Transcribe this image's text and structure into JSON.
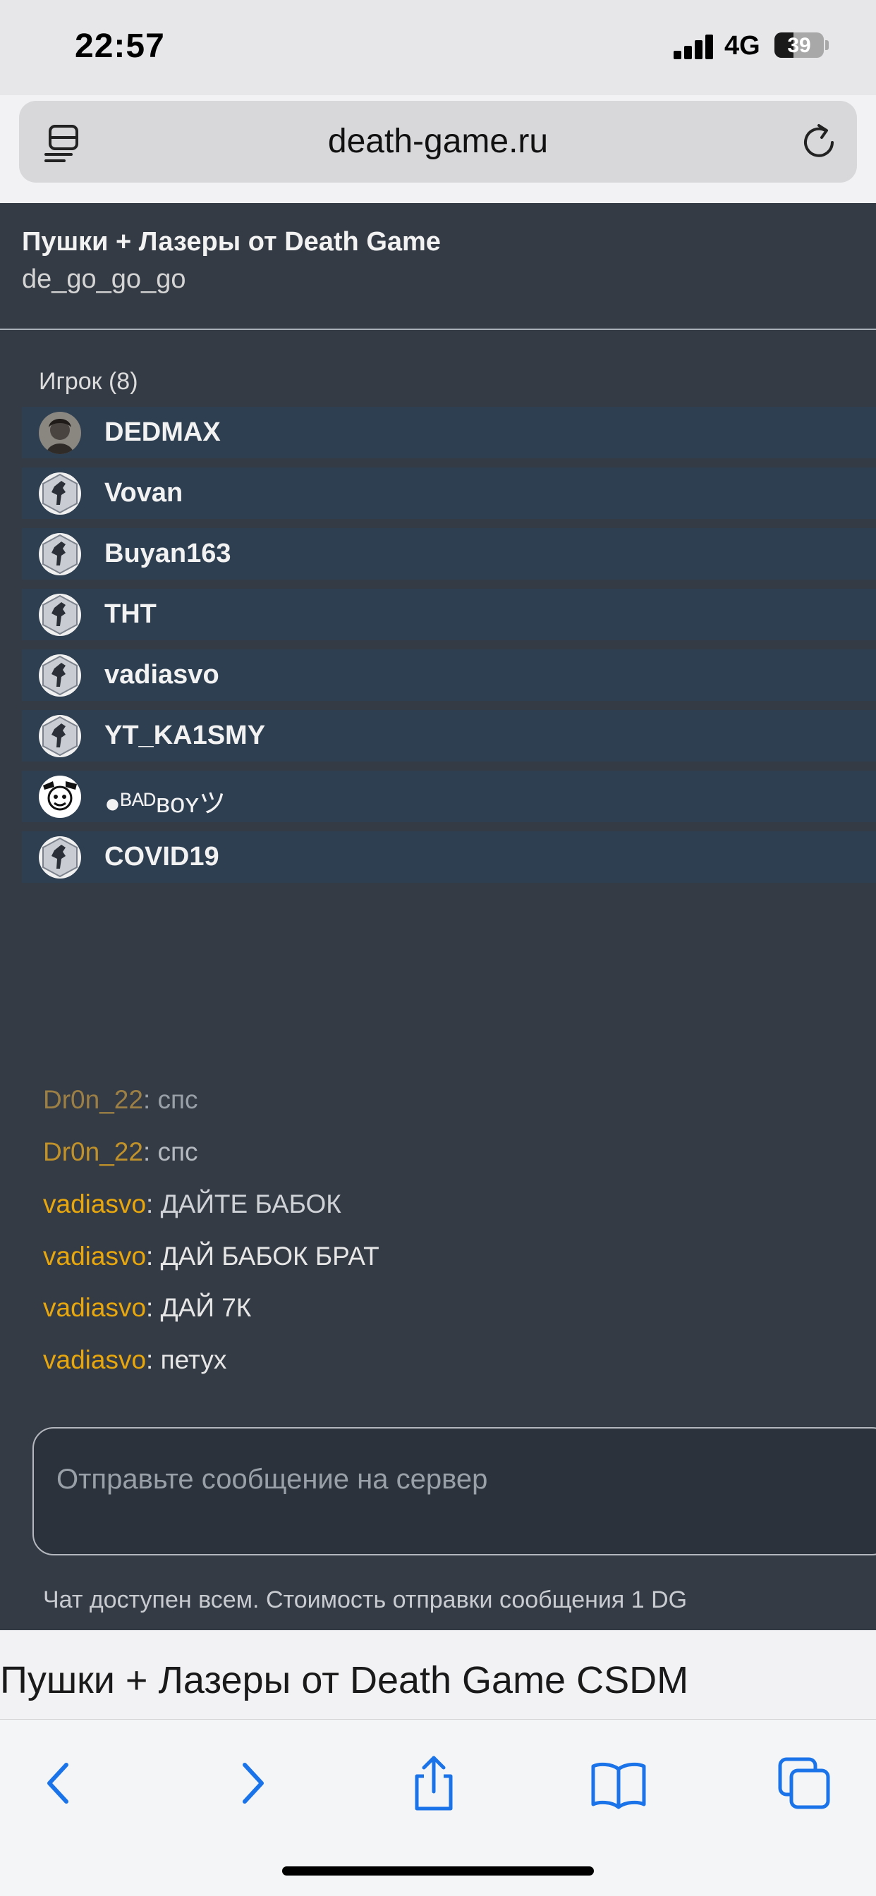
{
  "status": {
    "time": "22:57",
    "network": "4G",
    "battery": "39",
    "battery_level": 0.39
  },
  "browser": {
    "url": "death-game.ru"
  },
  "server": {
    "title": "Пушки + Лазеры от Death Game",
    "map": "de_go_go_go"
  },
  "players": {
    "label": "Игрок (8)",
    "list": [
      {
        "name": "DEDMAX",
        "avatar": "photo-avatar"
      },
      {
        "name": "Vovan",
        "avatar": "counter-strike-avatar"
      },
      {
        "name": "Buyan163",
        "avatar": "counter-strike-avatar"
      },
      {
        "name": "THT",
        "avatar": "counter-strike-avatar"
      },
      {
        "name": "vadiasvo",
        "avatar": "counter-strike-avatar"
      },
      {
        "name": "YT_KA1SMY",
        "avatar": "counter-strike-avatar"
      },
      {
        "name": "●ᴮᴬᴰʙᴏʏツ",
        "avatar": "badboy-avatar"
      },
      {
        "name": "COVID19",
        "avatar": "counter-strike-avatar"
      }
    ]
  },
  "chat": {
    "messages": [
      {
        "nick": "Dr0n_22",
        "text": ": спс"
      },
      {
        "nick": "Dr0n_22",
        "text": ": спс"
      },
      {
        "nick": "vadiasvo",
        "text": ": ДАЙТЕ БАБОК"
      },
      {
        "nick": "vadiasvo",
        "text": ": ДАЙ БАБОК БРАТ"
      },
      {
        "nick": "vadiasvo",
        "text": ": ДАЙ 7К"
      },
      {
        "nick": "vadiasvo",
        "text": ": петух"
      }
    ],
    "placeholder": "Отправьте сообщение на сервер",
    "note": "Чат доступен всем. Стоимость отправки сообщения 1 DG"
  },
  "page_heading": "Пушки + Лазеры от Death Game CSDM",
  "toolbar": {
    "icons": [
      "back-icon",
      "forward-icon",
      "share-icon",
      "bookmarks-icon",
      "tabs-icon"
    ]
  },
  "colors": {
    "panel": "#343b45",
    "player_row": "#2e3f52",
    "nick": "#e8a70d",
    "accent": "#1a73e8"
  }
}
